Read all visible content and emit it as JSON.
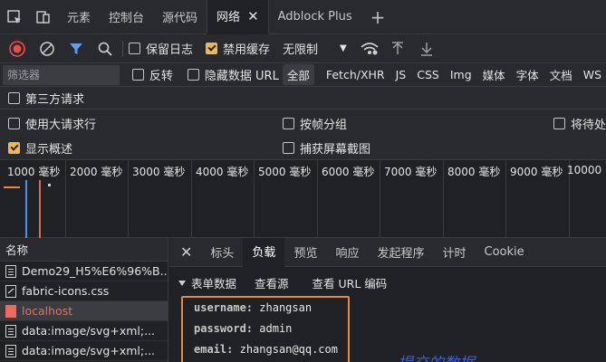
{
  "tabs": {
    "items": [
      {
        "label": "元素"
      },
      {
        "label": "控制台"
      },
      {
        "label": "源代码"
      },
      {
        "label": "网络"
      },
      {
        "label": "Adblock Plus"
      }
    ]
  },
  "toolbar": {
    "preserve_log": "保留日志",
    "disable_cache": "禁用缓存",
    "throttle": "无限制"
  },
  "filter": {
    "placeholder": "筛选器",
    "invert": "反转",
    "hide_data_urls": "隐藏数据 URL",
    "types": [
      "全部",
      "Fetch/XHR",
      "JS",
      "CSS",
      "Img",
      "媒体",
      "字体",
      "文档",
      "WS"
    ]
  },
  "options": {
    "third_party": "第三方请求",
    "large_rows": "使用大请求行",
    "group_by_frame": "按帧分组",
    "pending_label": "将待处",
    "show_overview": "显示概述",
    "capture_screenshots": "捕获屏幕截图"
  },
  "timeline": {
    "ticks": [
      "1000 毫秒",
      "2000 毫秒",
      "3000 毫秒",
      "4000 毫秒",
      "5000 毫秒",
      "6000 毫秒",
      "7000 毫秒",
      "8000 毫秒",
      "9000 毫秒",
      "10000"
    ]
  },
  "requests": {
    "header": "名称",
    "items": [
      {
        "name": "Demo29_H5%E6%96%B..."
      },
      {
        "name": "fabric-icons.css"
      },
      {
        "name": "localhost"
      },
      {
        "name": "data:image/svg+xml;..."
      },
      {
        "name": "data:image/svg+xml;..."
      }
    ]
  },
  "detail": {
    "tabs": [
      "标头",
      "负载",
      "预览",
      "响应",
      "发起程序",
      "计时",
      "Cookie"
    ],
    "section_title": "表单数据",
    "view_source": "查看源",
    "view_url_encoded": "查看 URL 编码",
    "fields": [
      {
        "key": "username:",
        "value": "zhangsan"
      },
      {
        "key": "password:",
        "value": "admin"
      },
      {
        "key": "email:",
        "value": "zhangsan@qq.com"
      }
    ],
    "annotation": "提交的数据"
  },
  "colors": {
    "accent_orange": "#e8883a",
    "checkbox_on": "#f2b64a",
    "record_red": "#ee4b4b",
    "filter_blue": "#5aa0f0",
    "annotation_blue": "#3b5fd6"
  }
}
